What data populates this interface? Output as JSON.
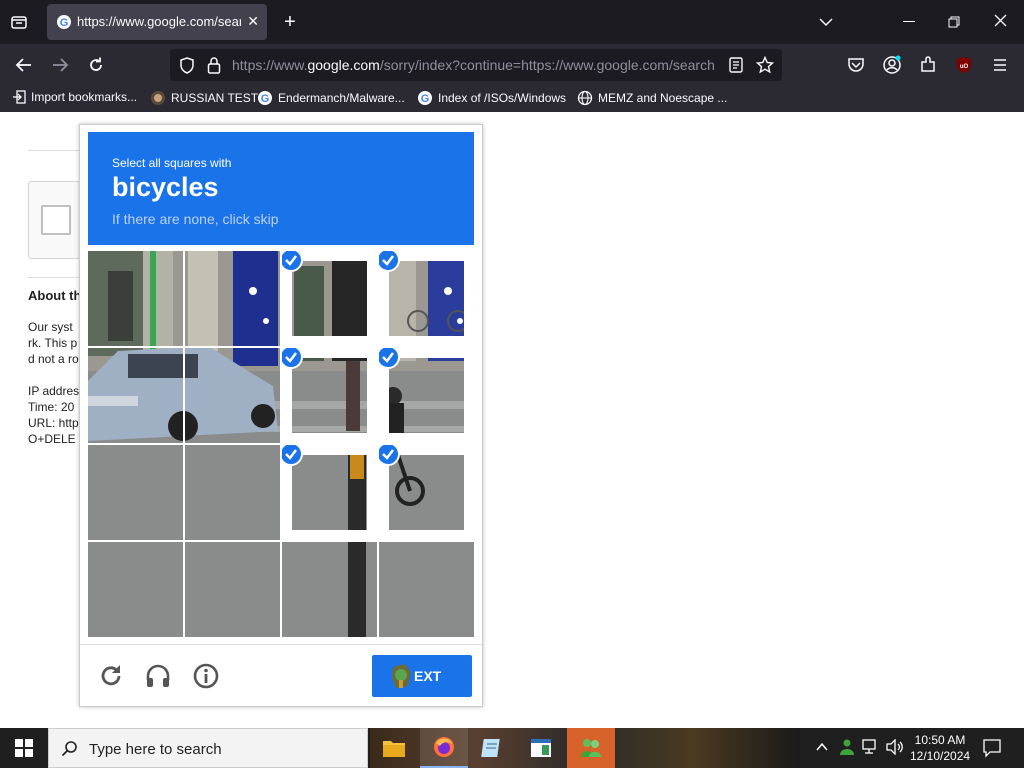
{
  "browser": {
    "tab_title": "https://www.google.com/search",
    "url_prefix": "https://www.",
    "url_domain": "google.com",
    "url_rest": "/sorry/index?continue=https://www.google.com/search",
    "bookmarks": [
      {
        "label": "Import bookmarks...",
        "icon": "import-icon"
      },
      {
        "label": "RUSSIAN TEST",
        "icon": "bookmark-favicon"
      },
      {
        "label": "Endermanch/Malware...",
        "icon": "google-icon"
      },
      {
        "label": "Index of /ISOs/Windows",
        "icon": "google-icon"
      },
      {
        "label": "MEMZ and Noescape ...",
        "icon": "globe-icon"
      }
    ]
  },
  "page": {
    "about_title": "About th",
    "lines": [
      "Our syst",
      "rk. This p",
      "d not a ro",
      "IP addres",
      "Time: 20",
      "URL: http",
      "O+DELE"
    ]
  },
  "captcha": {
    "instruction": "Select all squares with",
    "target": "bicycles",
    "hint": "If there are none, click skip",
    "next_label": "EXT",
    "selected_cells": [
      2,
      3,
      6,
      7,
      10,
      11
    ]
  },
  "taskbar": {
    "search_placeholder": "Type here to search",
    "time": "10:50 AM",
    "date": "12/10/2024"
  },
  "colors": {
    "accent": "#1a73e8",
    "chrome_dark": "#1c1b22",
    "chrome": "#2b2a33"
  }
}
